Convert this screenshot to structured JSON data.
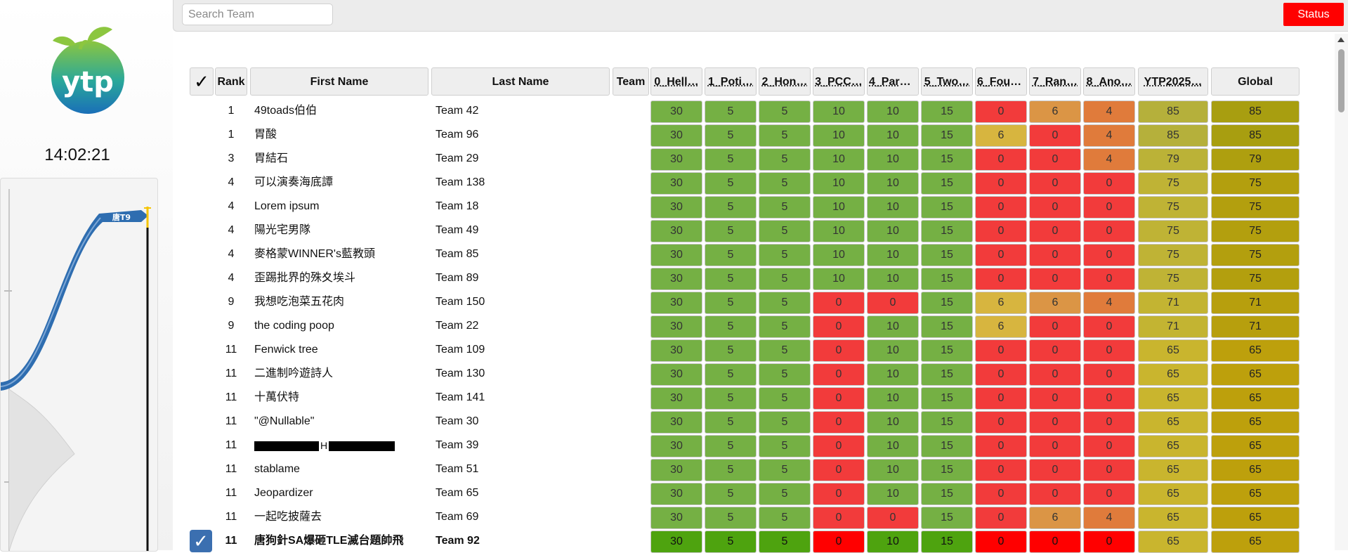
{
  "logo_text": "ytp",
  "clock": "14:02:21",
  "graph": {
    "team_label": "唐T9"
  },
  "search": {
    "placeholder": "Search Team",
    "value": ""
  },
  "status_label": "Status",
  "header_check": "✓",
  "columns": {
    "rank": "Rank",
    "first_name": "First Name",
    "last_name": "Last Name",
    "team": "Team",
    "problems": [
      "0_Hell…",
      "1_Poti…",
      "2_Hon…",
      "3_PCC…",
      "4_Park…",
      "5_Two…",
      "6_Four…",
      "7_Ran…",
      "8_Ano…"
    ],
    "ytp": "YTP2025…",
    "global": "Global"
  },
  "colors": {
    "full": "#75b044",
    "zero": "#f23b3b",
    "partial_6_four": "#d7b53f",
    "partial_7": "#db9545",
    "partial_8": "#e07b3b",
    "ytp_85": "#b5b03b",
    "global_85": "#a89e10",
    "highlight_full": "#4ea30f",
    "highlight_zero": "#ff0000"
  },
  "rows": [
    {
      "rank": "1",
      "first_name": "49toads伯伯",
      "last_name": "Team 42",
      "scores": [
        "30",
        "5",
        "5",
        "10",
        "10",
        "15",
        "0",
        "6",
        "4"
      ],
      "ytp": "85",
      "global": "85"
    },
    {
      "rank": "1",
      "first_name": "胃酸",
      "last_name": "Team 96",
      "scores": [
        "30",
        "5",
        "5",
        "10",
        "10",
        "15",
        "6",
        "0",
        "4"
      ],
      "ytp": "85",
      "global": "85"
    },
    {
      "rank": "3",
      "first_name": "胃結石",
      "last_name": "Team 29",
      "scores": [
        "30",
        "5",
        "5",
        "10",
        "10",
        "15",
        "0",
        "0",
        "4"
      ],
      "ytp": "79",
      "global": "79"
    },
    {
      "rank": "4",
      "first_name": "可以演奏海底譚",
      "last_name": "Team 138",
      "scores": [
        "30",
        "5",
        "5",
        "10",
        "10",
        "15",
        "0",
        "0",
        "0"
      ],
      "ytp": "75",
      "global": "75"
    },
    {
      "rank": "4",
      "first_name": "Lorem ipsum",
      "last_name": "Team 18",
      "scores": [
        "30",
        "5",
        "5",
        "10",
        "10",
        "15",
        "0",
        "0",
        "0"
      ],
      "ytp": "75",
      "global": "75"
    },
    {
      "rank": "4",
      "first_name": "陽光宅男隊",
      "last_name": "Team 49",
      "scores": [
        "30",
        "5",
        "5",
        "10",
        "10",
        "15",
        "0",
        "0",
        "0"
      ],
      "ytp": "75",
      "global": "75"
    },
    {
      "rank": "4",
      "first_name": "麥格蒙WINNER's藍教頭",
      "last_name": "Team 85",
      "scores": [
        "30",
        "5",
        "5",
        "10",
        "10",
        "15",
        "0",
        "0",
        "0"
      ],
      "ytp": "75",
      "global": "75"
    },
    {
      "rank": "4",
      "first_name": "歪踢批界的殊夊埃斗",
      "last_name": "Team 89",
      "scores": [
        "30",
        "5",
        "5",
        "10",
        "10",
        "15",
        "0",
        "0",
        "0"
      ],
      "ytp": "75",
      "global": "75"
    },
    {
      "rank": "9",
      "first_name": "我想吃泡菜五花肉",
      "last_name": "Team 150",
      "scores": [
        "30",
        "5",
        "5",
        "0",
        "0",
        "15",
        "6",
        "6",
        "4"
      ],
      "ytp": "71",
      "global": "71"
    },
    {
      "rank": "9",
      "first_name": "the coding poop",
      "last_name": "Team 22",
      "scores": [
        "30",
        "5",
        "5",
        "0",
        "10",
        "15",
        "6",
        "0",
        "0"
      ],
      "ytp": "71",
      "global": "71"
    },
    {
      "rank": "11",
      "first_name": "Fenwick tree",
      "last_name": "Team 109",
      "scores": [
        "30",
        "5",
        "5",
        "0",
        "10",
        "15",
        "0",
        "0",
        "0"
      ],
      "ytp": "65",
      "global": "65"
    },
    {
      "rank": "11",
      "first_name": "二進制吟遊詩人",
      "last_name": "Team 130",
      "scores": [
        "30",
        "5",
        "5",
        "0",
        "10",
        "15",
        "0",
        "0",
        "0"
      ],
      "ytp": "65",
      "global": "65"
    },
    {
      "rank": "11",
      "first_name": "十萬伏特",
      "last_name": "Team 141",
      "scores": [
        "30",
        "5",
        "5",
        "0",
        "10",
        "15",
        "0",
        "0",
        "0"
      ],
      "ytp": "65",
      "global": "65"
    },
    {
      "rank": "11",
      "first_name": "\"@Nullable\"",
      "last_name": "Team 30",
      "scores": [
        "30",
        "5",
        "5",
        "0",
        "10",
        "15",
        "0",
        "0",
        "0"
      ],
      "ytp": "65",
      "global": "65"
    },
    {
      "rank": "11",
      "first_name": "",
      "redacted": true,
      "last_name": "Team 39",
      "scores": [
        "30",
        "5",
        "5",
        "0",
        "10",
        "15",
        "0",
        "0",
        "0"
      ],
      "ytp": "65",
      "global": "65"
    },
    {
      "rank": "11",
      "first_name": "stablame",
      "last_name": "Team 51",
      "scores": [
        "30",
        "5",
        "5",
        "0",
        "10",
        "15",
        "0",
        "0",
        "0"
      ],
      "ytp": "65",
      "global": "65"
    },
    {
      "rank": "11",
      "first_name": "Jeopardizer",
      "last_name": "Team 65",
      "scores": [
        "30",
        "5",
        "5",
        "0",
        "10",
        "15",
        "0",
        "0",
        "0"
      ],
      "ytp": "65",
      "global": "65"
    },
    {
      "rank": "11",
      "first_name": "一起吃披薩去",
      "last_name": "Team 69",
      "scores": [
        "30",
        "5",
        "5",
        "0",
        "0",
        "15",
        "0",
        "6",
        "4"
      ],
      "ytp": "65",
      "global": "65"
    },
    {
      "rank": "11",
      "first_name": "唐狗針SA爆砸TLE滅台題帥飛",
      "last_name": "Team 92",
      "scores": [
        "30",
        "5",
        "5",
        "0",
        "10",
        "15",
        "0",
        "0",
        "0"
      ],
      "ytp": "65",
      "global": "65",
      "highlight": true,
      "checked": true
    }
  ]
}
